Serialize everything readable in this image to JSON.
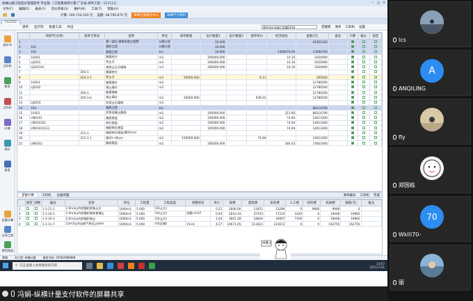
{
  "app": {
    "title": "纵横公路工程造价管理软件 专业版 - [工程量清单计量·广东省·清单工程 - 111111]",
    "menus": [
      "文件(F)",
      "编辑(E)",
      "报表(Y)",
      "造价审核(S)",
      "维护(W)",
      "工具(T)",
      "帮助(H)"
    ],
    "toolbar": {
      "label": "计算: 100,724,520 元",
      "label2": "差额: 48,790,872 元",
      "btn_orange": "纵横正版服务中心",
      "btn_blue": "纵横学习资料"
    },
    "doc_tab": "111111",
    "sub_tools": [
      "清单",
      "显示列",
      "批量工具",
      "导出"
    ],
    "quota_select": "养护设计及施工定额2018",
    "right_tools": [
      "定额库",
      "清单",
      "工料机",
      "设置"
    ]
  },
  "left_nav": [
    "造价书",
    "工料机",
    "费率",
    "工料机",
    "分摊",
    "调价",
    "报表"
  ],
  "left_nav2": [
    "定额计算",
    "分项工程",
    "费用构成"
  ],
  "main_table": {
    "headers": [
      "",
      "项目节(分项)",
      "清单子目号",
      "名称",
      "单位",
      "清单数量",
      "设计数量1",
      "设计数量2",
      "清单单价",
      "经济指标",
      "金额(元)",
      "备注",
      "计算",
      "备价",
      "锁定"
    ],
    "rows": [
      {
        "no": "1",
        "code": "",
        "item": "",
        "name": "第一部分 建筑安装工程费",
        "unit": "公路公里",
        "qty": "",
        "d1": "10.000",
        "d2": "",
        "price": "",
        "idx": "",
        "amount": "01855320",
        "cls": "blue"
      },
      {
        "no": "2",
        "code": "101",
        "item": "",
        "name": "临时工程",
        "unit": "公路公里",
        "qty": "",
        "d1": "10.000",
        "d2": "",
        "price": "",
        "idx": "",
        "amount": "",
        "cls": "blue"
      },
      {
        "no": "3",
        "code": "102",
        "item": "",
        "name": "路基工程",
        "unit": "km",
        "qty": "",
        "d1": "10.000",
        "d2": "",
        "price": "",
        "idx": "1309070.00",
        "amount": "13090700",
        "cls": "blue"
      },
      {
        "no": "4",
        "code": "10202",
        "item": "",
        "name": "路基挖方",
        "unit": "m3",
        "qty": "",
        "d1": "200000.000",
        "d2": "",
        "price": "",
        "idx": "10.10",
        "amount": "2020000",
        "cls": ""
      },
      {
        "no": "5",
        "code": "LJ0201",
        "item": "",
        "name": "挖土方",
        "unit": "m3",
        "qty": "",
        "d1": "200000.000",
        "d2": "",
        "price": "",
        "idx": "10.10",
        "amount": "2020000",
        "cls": ""
      },
      {
        "no": "6",
        "code": "LJ020101",
        "item": "",
        "name": "挖除土石方填筑",
        "unit": "m3",
        "qty": "",
        "d1": "200000.000",
        "d2": "",
        "price": "",
        "idx": "10.10",
        "amount": "2020000",
        "cls": ""
      },
      {
        "no": "7",
        "code": "",
        "item": "203-1",
        "name": "路基挖方",
        "unit": "",
        "qty": "",
        "d1": "",
        "d2": "",
        "price": "",
        "idx": "",
        "amount": "",
        "cls": ""
      },
      {
        "no": "8",
        "code": "",
        "item": "203-1-1",
        "name": "挖土方",
        "unit": "m3",
        "qty": "50000.000",
        "d1": "",
        "d2": "",
        "price": "6.11",
        "idx": "",
        "amount": "305500",
        "cls": "sel"
      },
      {
        "no": "9",
        "code": "10203",
        "item": "",
        "name": "路基填方",
        "unit": "m3",
        "qty": "",
        "d1": "",
        "d2": "",
        "price": "",
        "idx": "",
        "amount": "12780200",
        "cls": ""
      },
      {
        "no": "10",
        "code": "LJ0202",
        "item": "",
        "name": "借土填方",
        "unit": "m3",
        "qty": "",
        "d1": "",
        "d2": "",
        "price": "",
        "idx": "",
        "amount": "12780200",
        "cls": ""
      },
      {
        "no": "11",
        "code": "",
        "item": "204-1",
        "name": "路基填筑",
        "unit": "",
        "qty": "",
        "d1": "",
        "d2": "",
        "price": "",
        "idx": "",
        "amount": "12780200",
        "cls": ""
      },
      {
        "no": "12",
        "code": "",
        "item": "204-1-b",
        "name": "借土填方",
        "unit": "m3",
        "qty": "20000.000",
        "d1": "",
        "d2": "",
        "price": "639.01",
        "idx": "",
        "amount": "12780200",
        "cls": ""
      },
      {
        "no": "13",
        "code": "LJ0203",
        "item": "",
        "name": "利用土石填筑",
        "unit": "m3",
        "qty": "",
        "d1": "",
        "d2": "",
        "price": "",
        "idx": "",
        "amount": "",
        "cls": ""
      },
      {
        "no": "14",
        "code": "103",
        "item": "",
        "name": "路面工程",
        "unit": "km",
        "qty": "",
        "d1": "",
        "d2": "",
        "price": "",
        "idx": "",
        "amount": "88214700",
        "cls": "blue"
      },
      {
        "no": "15",
        "code": "10301",
        "item": "",
        "name": "沥青混凝土路面",
        "unit": "m2",
        "qty": "",
        "d1": "195000.000",
        "d2": "",
        "price": "",
        "idx": "313.60",
        "amount": "88214700",
        "cls": ""
      },
      {
        "no": "16",
        "code": "LM0101",
        "item": "",
        "name": "路面垫层",
        "unit": "m2",
        "qty": "",
        "d1": "195000.000",
        "d2": "",
        "price": "",
        "idx": "74.94",
        "amount": "14613300",
        "cls": ""
      },
      {
        "no": "17",
        "code": "LM010101",
        "item": "",
        "name": "碎石垫层",
        "unit": "m2",
        "qty": "",
        "d1": "195000.000",
        "d2": "",
        "price": "",
        "idx": "74.94",
        "amount": "14613300",
        "cls": ""
      },
      {
        "no": "18",
        "code": "LM01010111",
        "item": "",
        "name": "级配碎石垫层",
        "unit": "m2",
        "qty": "",
        "d1": "195000.000",
        "d2": "",
        "price": "",
        "idx": "74.94",
        "amount": "14613300",
        "cls": ""
      },
      {
        "no": "19",
        "code": "",
        "item": "311-1",
        "name": "级配碎石垫层(厚20cm)",
        "unit": "",
        "qty": "",
        "d1": "",
        "d2": "",
        "price": "",
        "idx": "",
        "amount": "",
        "cls": ""
      },
      {
        "no": "20",
        "code": "",
        "item": "311-1-1",
        "name": "厚20~40cm",
        "unit": "m2",
        "qty": "195000.000",
        "d1": "",
        "d2": "",
        "price": "74.94",
        "idx": "",
        "amount": "14613300",
        "cls": ""
      },
      {
        "no": "21",
        "code": "LM0102",
        "item": "",
        "name": "路面基层",
        "unit": "m2",
        "qty": "",
        "d1": "195000.000",
        "d2": "",
        "price": "",
        "idx": "346.43",
        "amount": "73601400",
        "cls": ""
      }
    ]
  },
  "bottom_tabs": {
    "left": [
      "定额计算",
      "工料机",
      "设备购置"
    ],
    "right": [
      "清单编号",
      "工料机",
      "完成"
    ]
  },
  "quota_table": {
    "headers": [
      "",
      "锁定",
      "调整",
      "编号",
      "名称",
      "单位",
      "工程量",
      "工程类型",
      "调整状态",
      "单价",
      "取费",
      "建筑费",
      "安装费",
      "人工费",
      "材料费",
      "机械费",
      "金额(元)",
      "备注"
    ],
    "rows": [
      [
        "1",
        "",
        "",
        "1-1-11-1",
        "2.0m3以内挖掘机挖装土方",
        "1000m3",
        "5.000",
        "03(土方)",
        "",
        "0.21",
        "2606.00",
        "13451",
        "13296",
        "0",
        "9968",
        "9968",
        "0"
      ],
      [
        "2",
        "",
        "",
        "1-1-10-1",
        "2.0m3以内挖掘机装车普通土",
        "1000m3",
        "5.000",
        "03(土方)",
        "定额×0.67",
        "0.93",
        "2616.33",
        "25703",
        "17224",
        "3229",
        "0",
        "19406",
        "19965"
      ],
      [
        "3",
        "",
        "",
        "1-1-10-3",
        "2.0m3以内挖掘机装土",
        "1000m3",
        "5.000",
        "03(土方)",
        "",
        "1.04",
        "3601.39",
        "18004",
        "16907",
        "7109",
        "0",
        "19406",
        "19965"
      ],
      [
        "4",
        "",
        "",
        "1-1-11-7",
        "12m3以内自卸汽车运土4km",
        "1000m3",
        "5.000",
        "03(运输)",
        "15+6",
        "4.27",
        "10671.05",
        "213423",
        "223672",
        "0",
        "0",
        "162755",
        "162755"
      ]
    ]
  },
  "status_bar": [
    "就绪",
    "本工程: 纵横计量",
    "服务号码: 20562088888"
  ],
  "taskbar": {
    "search_placeholder": "在这里输入你要搜索的内容",
    "time": "14:07",
    "date": "2021/7/31"
  },
  "sticker_text": "中两十",
  "share_caption": "冯娟-纵横计量支付软件的屏幕共享",
  "participants": [
    {
      "name": "lcs",
      "type": "photo"
    },
    {
      "name": "ANQILING",
      "type": "letter",
      "letter": "A"
    },
    {
      "name": "fly",
      "type": "photo"
    },
    {
      "name": "郑国栋",
      "type": "cartoon"
    },
    {
      "name": "Wklll70-",
      "type": "number",
      "letter": "70"
    },
    {
      "name": "丽",
      "type": "photo"
    }
  ]
}
